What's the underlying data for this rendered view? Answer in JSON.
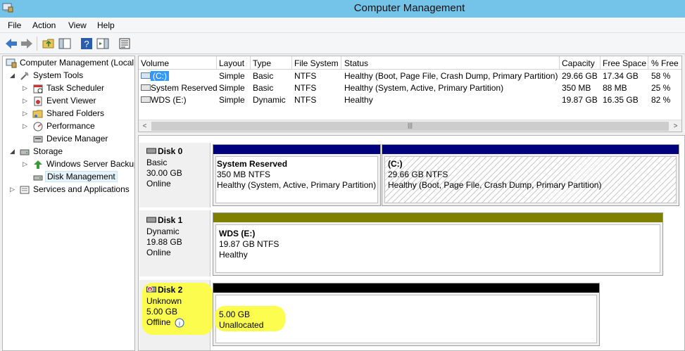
{
  "window": {
    "title": "Computer Management"
  },
  "menu": [
    "File",
    "Action",
    "View",
    "Help"
  ],
  "tree": {
    "root": "Computer Management (Local",
    "system_tools": "System Tools",
    "task_scheduler": "Task Scheduler",
    "event_viewer": "Event Viewer",
    "shared_folders": "Shared Folders",
    "performance": "Performance",
    "device_manager": "Device Manager",
    "storage": "Storage",
    "windows_server_backup": "Windows Server Backup",
    "disk_management": "Disk Management",
    "services_apps": "Services and Applications"
  },
  "volumes": {
    "columns": [
      "Volume",
      "Layout",
      "Type",
      "File System",
      "Status",
      "Capacity",
      "Free Space",
      "% Free"
    ],
    "rows": [
      {
        "volume": "(C:)",
        "layout": "Simple",
        "type": "Basic",
        "fs": "NTFS",
        "status": "Healthy (Boot, Page File, Crash Dump, Primary Partition)",
        "capacity": "29.66 GB",
        "free": "17.34 GB",
        "pct": "58 %"
      },
      {
        "volume": "System Reserved",
        "layout": "Simple",
        "type": "Basic",
        "fs": "NTFS",
        "status": "Healthy (System, Active, Primary Partition)",
        "capacity": "350 MB",
        "free": "88 MB",
        "pct": "25 %"
      },
      {
        "volume": "WDS (E:)",
        "layout": "Simple",
        "type": "Dynamic",
        "fs": "NTFS",
        "status": "Healthy",
        "capacity": "19.87 GB",
        "free": "16.35 GB",
        "pct": "82 %"
      }
    ]
  },
  "disks": {
    "disk0": {
      "name": "Disk 0",
      "type": "Basic",
      "size": "30.00 GB",
      "state": "Online",
      "p1": {
        "name": "System Reserved",
        "size": "350 MB NTFS",
        "status": "Healthy (System, Active, Primary Partition)"
      },
      "p2": {
        "name": "(C:)",
        "size": "29.66 GB NTFS",
        "status": "Healthy (Boot, Page File, Crash Dump, Primary Partition)"
      }
    },
    "disk1": {
      "name": "Disk 1",
      "type": "Dynamic",
      "size": "19.88 GB",
      "state": "Online",
      "p1": {
        "name": "WDS  (E:)",
        "size": "19.87 GB NTFS",
        "status": "Healthy"
      }
    },
    "disk2": {
      "name": "Disk 2",
      "type": "Unknown",
      "size": "5.00 GB",
      "state": "Offline",
      "p1": {
        "size": "5.00 GB",
        "status": "Unallocated"
      }
    }
  },
  "colors": {
    "titlebar": "#74c3e8",
    "primary": "#00007f",
    "dynamic_simple": "#7f7f00",
    "unallocated": "#000000",
    "highlight": "#fdfd3c"
  }
}
